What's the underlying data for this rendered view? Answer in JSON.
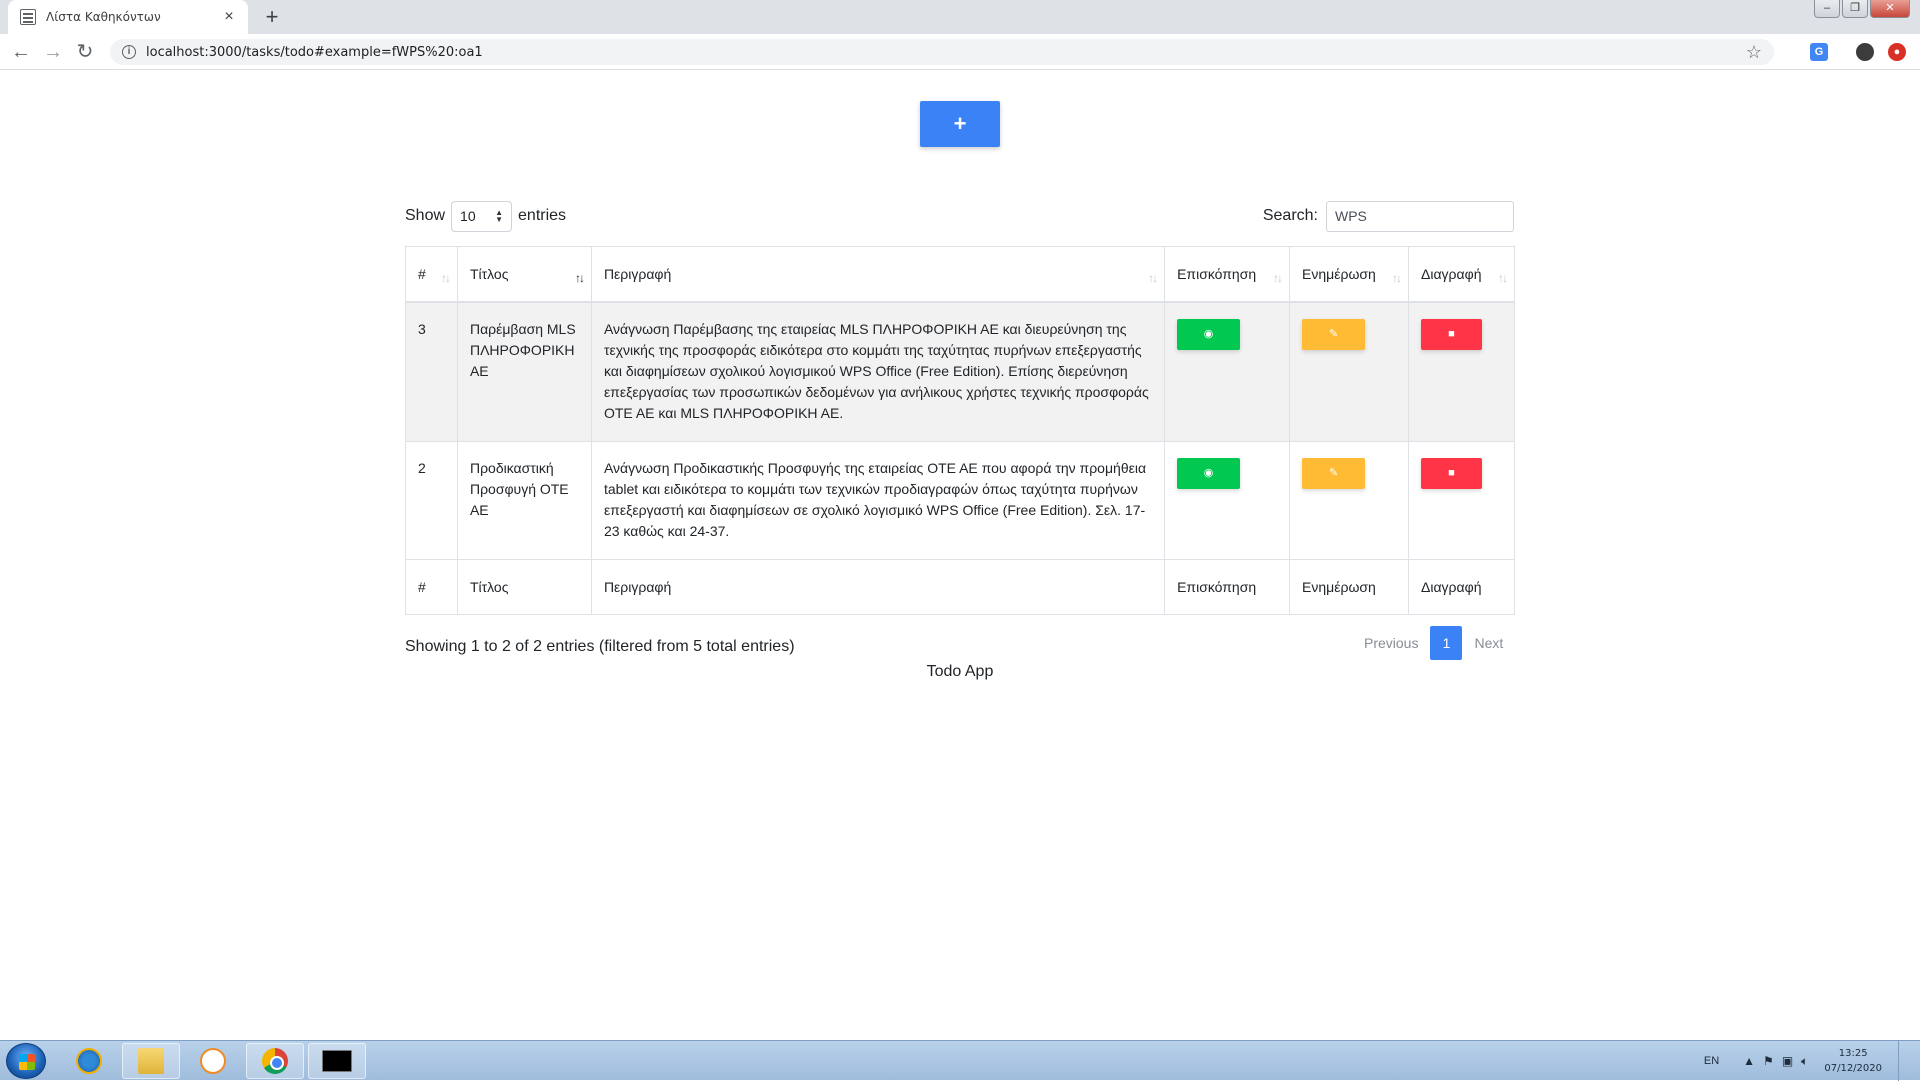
{
  "browser": {
    "tab_title": "Λίστα Καθηκόντων",
    "tab_close": "×",
    "new_tab": "+",
    "url": "localhost:3000/tasks/todo#example=fWPS%20:oa1"
  },
  "page": {
    "add_button": "+",
    "length": {
      "show": "Show",
      "value": "10",
      "entries": "entries"
    },
    "search": {
      "label": "Search:",
      "value": "WPS"
    },
    "columns": [
      "#",
      "Τίτλος",
      "Περιγραφή",
      "Επισκόπηση",
      "Ενημέρωση",
      "Διαγραφή"
    ],
    "rows": [
      {
        "id": "3",
        "title": "Παρέμβαση MLS ΠΛΗΡΟΦΟΡΙΚΗ ΑΕ",
        "description": "Ανάγνωση Παρέμβασης της εταιρείας MLS ΠΛΗΡΟΦΟΡΙΚΗ ΑΕ και διευρεύνηση της τεχνικής της προσφοράς ειδικότερα στο κομμάτι της ταχύτητας πυρήνων επεξεργαστής και διαφημίσεων σχολικού λογισμικού WPS Office (Free Edition). Επίσης διερεύνηση επεξεργασίας των προσωπικών δεδομένων για ανήλικους χρήστες τεχνικής προσφοράς ΟΤΕ ΑΕ και MLS ΠΛΗΡΟΦΟΡΙΚΗ ΑΕ."
      },
      {
        "id": "2",
        "title": "Προδικαστική Προσφυγή ΟΤΕ ΑΕ",
        "description": "Ανάγνωση Προδικαστικής Προσφυγής της εταιρείας ΟΤΕ ΑΕ που αφορά την προμήθεια tablet και ειδικότερα το κομμάτι των τεχνικών προδιαγραφών όπως ταχύτητα πυρήνων επεξεργαστή και διαφημίσεων σε σχολικό λογισμικό WPS Office (Free Edition). Σελ. 17-23 καθώς και 24-37."
      }
    ],
    "info": "Showing 1 to 2 of 2 entries (filtered from 5 total entries)",
    "pagination": {
      "previous": "Previous",
      "current": "1",
      "next": "Next"
    },
    "footer": "Todo App"
  },
  "taskbar": {
    "language": "EN",
    "time": "13:25",
    "date": "07/12/2020"
  },
  "colors": {
    "primary": "#3b82f6",
    "view": "#00c851",
    "edit": "#ffbb33",
    "delete": "#ff3547"
  }
}
